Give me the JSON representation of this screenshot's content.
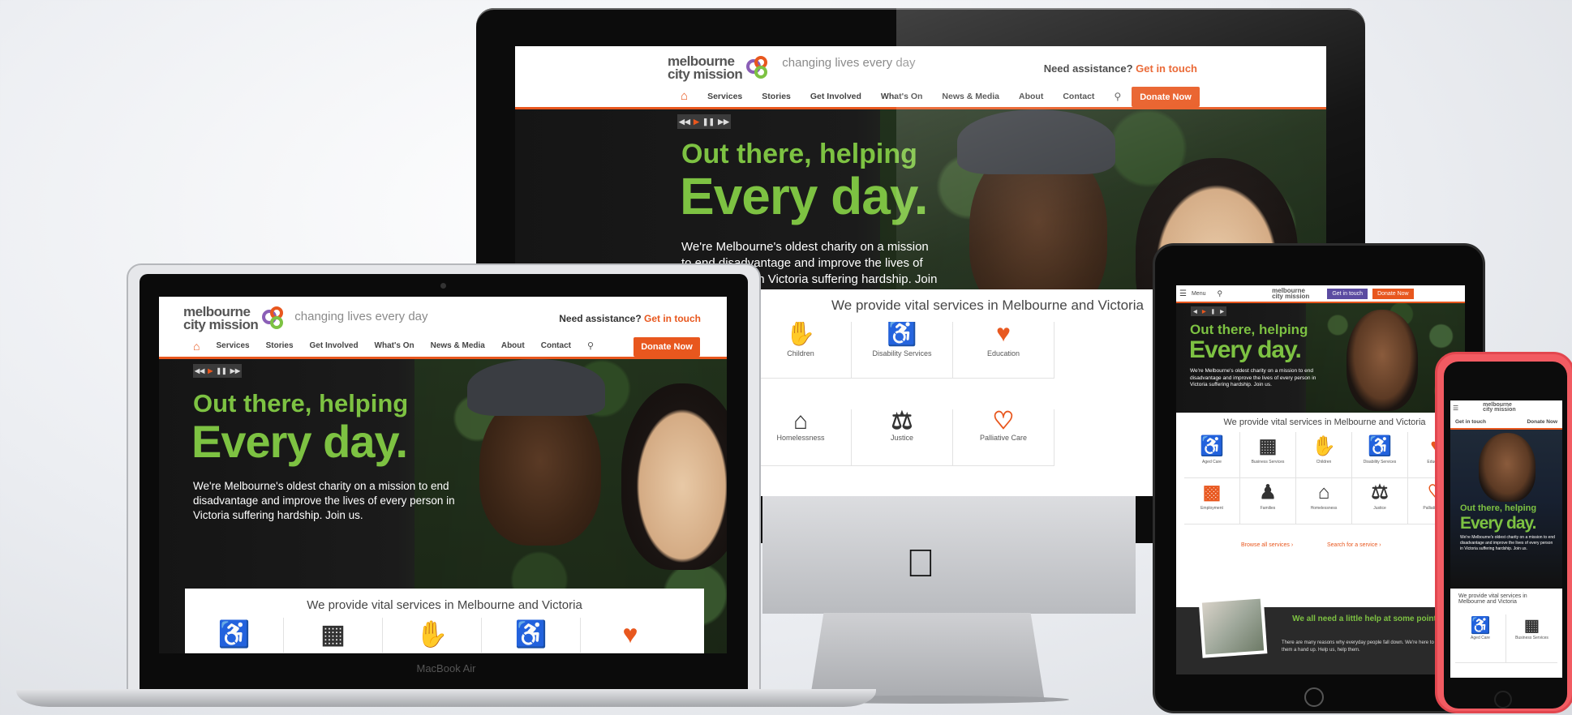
{
  "site": {
    "logo_line1": "melbourne",
    "logo_line2": "city mission",
    "tagline": "changing lives every day",
    "assist_label": "Need assistance?",
    "assist_link": "Get in touch",
    "nav": [
      "Services",
      "Stories",
      "Get Involved",
      "What's On",
      "News & Media",
      "About",
      "Contact"
    ],
    "donate": "Donate Now",
    "menu_label": "Menu",
    "hero_line1": "Out there, helping",
    "hero_line2": "Every day.",
    "hero_text": "We're Melbourne's oldest charity on a mission to end disadvantage and improve the lives of every person in Victoria suffering hardship. Join us.",
    "services_title": "We provide vital services in Melbourne and Victoria",
    "services": [
      "Aged Care",
      "Business Services",
      "Children",
      "Disability Services",
      "Education",
      "Employment",
      "Families",
      "Homelessness",
      "Justice",
      "Palliative Care"
    ],
    "browse_all": "Browse all services",
    "search_service": "Search for a service",
    "help_title": "We all need a little help at some point",
    "help_text": "There are many reasons why everyday people fall down. We're here to give them a hand up. Help us, help them."
  },
  "device": {
    "laptop_brand": "MacBook Air"
  },
  "colors": {
    "brand_orange": "#e8571e",
    "hero_green": "#7dc242",
    "phone_body": "#f25b62"
  }
}
